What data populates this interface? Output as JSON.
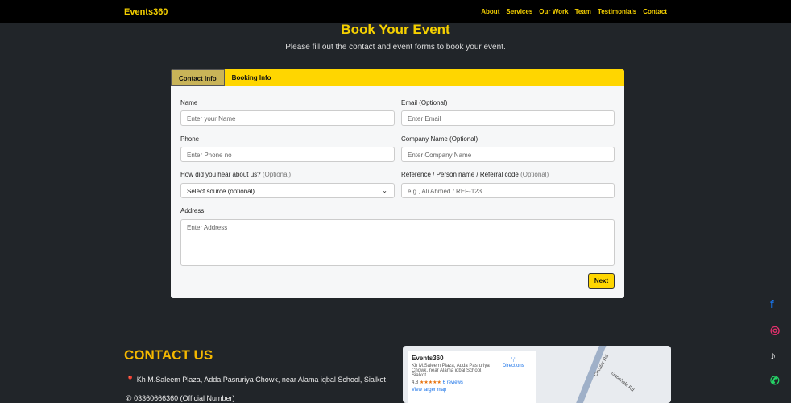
{
  "nav": {
    "brand": "Events360",
    "links": [
      "About",
      "Services",
      "Our Work",
      "Team",
      "Testimonials",
      "Contact"
    ]
  },
  "hero": {
    "title": "Book Your Event",
    "subtitle": "Please fill out the contact and event forms to book your event."
  },
  "tabs": [
    "Contact Info",
    "Booking Info"
  ],
  "form": {
    "name": {
      "label": "Name",
      "placeholder": "Enter your Name"
    },
    "email": {
      "label": "Email (Optional)",
      "placeholder": "Enter Email"
    },
    "phone": {
      "label": "Phone",
      "placeholder": "Enter Phone no"
    },
    "company": {
      "label": "Company Name (Optional)",
      "placeholder": "Enter Company Name"
    },
    "source": {
      "label": "How did you hear about us?",
      "optional": "(Optional)",
      "value": "Select source (optional)"
    },
    "reference": {
      "label": "Reference / Person name / Referral code",
      "optional": "(Optional)",
      "placeholder": "e.g., Ali Ahmed / REF-123"
    },
    "address": {
      "label": "Address",
      "placeholder": "Enter Address"
    },
    "next": "Next"
  },
  "contact": {
    "title": "CONTACT US",
    "address": "Kh M.Saleem Plaza, Adda Pasruriya Chowk, near Alama iqbal School, Sialkot",
    "phone": "03360666360 (Official Number)"
  },
  "map": {
    "name": "Events360",
    "address": "Kh M.Saleem Plaza, Adda Pasruriya Chowk, near Alama iqbal School, Sialkot",
    "rating": "4.8",
    "stars": "★★★★★",
    "reviews": "6 reviews",
    "directions": "Directions",
    "larger": "View larger map",
    "road1": "Circular Rd",
    "road2": "Gaoshala Rd"
  }
}
